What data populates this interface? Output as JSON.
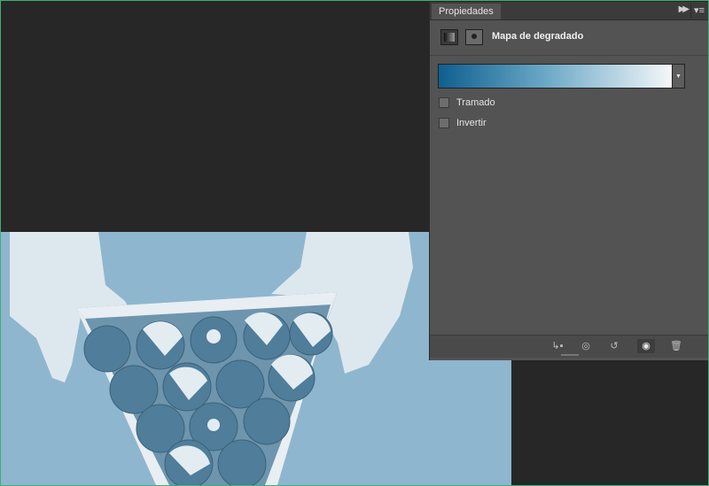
{
  "panel": {
    "tab_label": "Propiedades",
    "title": "Mapa de degradado",
    "options": [
      {
        "label": "Tramado",
        "checked": false
      },
      {
        "label": "Invertir",
        "checked": false
      }
    ],
    "gradient_colors": [
      "#0e5f8e",
      "#6aa7c6",
      "#f4f7f9"
    ]
  },
  "icons": {
    "collapse": "double-chevron-right-icon",
    "menu": "panel-menu-icon",
    "adjustment": "gradient-map-icon",
    "mask": "layer-mask-icon",
    "clip": "clip-to-layer-icon",
    "view_previous": "view-previous-state-icon",
    "reset": "reset-icon",
    "visibility": "eye-icon",
    "delete": "trash-icon"
  },
  "colors": {
    "panel_bg": "#535353",
    "canvas_bg": "#272727",
    "photo_tint": "#8fb6cf",
    "frame": "#3fae78"
  }
}
